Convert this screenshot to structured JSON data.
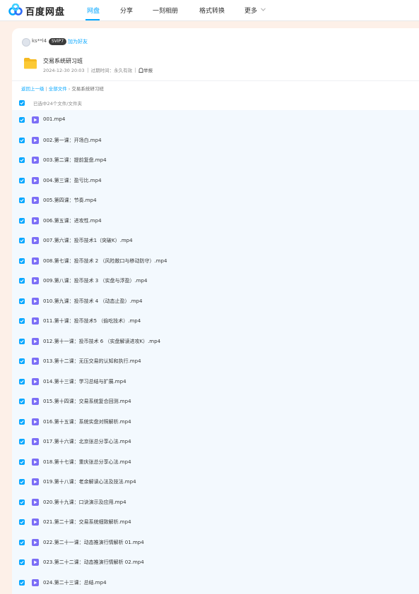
{
  "header": {
    "brand": "百度网盘",
    "nav": [
      "网盘",
      "分享",
      "一刻相册",
      "格式转换",
      "更多"
    ]
  },
  "colors": {
    "accent": "#06a7ff",
    "video_icon": "#7b6ef6",
    "list_bg": "#f3f9fe"
  },
  "share": {
    "username": "ks**l4",
    "vip": "SVIP7",
    "add_friend": "加为好友",
    "title": "交易系统研习班",
    "date": "2024-12-30 20:03",
    "expiry_label": "过期时间：",
    "expiry_value": "永久有效",
    "report": "举报"
  },
  "breadcrumb": {
    "back": "返回上一级",
    "all": "全部文件",
    "sep": "›",
    "current": "交易系统研习班"
  },
  "select_all": {
    "label": "已选中24个文件/文件夹"
  },
  "files": [
    {
      "name": "001.mp4"
    },
    {
      "name": "002.第一课：开场白.mp4"
    },
    {
      "name": "003.第二课：提前复盘.mp4"
    },
    {
      "name": "004.第三课：盈亏比.mp4"
    },
    {
      "name": "005.第四课：节奏.mp4"
    },
    {
      "name": "006.第五课：进攻性.mp4"
    },
    {
      "name": "007.第六课：投币技术1（突破K）.mp4"
    },
    {
      "name": "008.第七课：投币技术 2 （风险敞口与移动防守）.mp4"
    },
    {
      "name": "009.第八课：投币技术 3 （实盘与浮盈）.mp4"
    },
    {
      "name": "010.第九课：投币技术 4 （动态止盈）.mp4"
    },
    {
      "name": "011.第十课：投币技术5 （偷吃技术）.mp4"
    },
    {
      "name": "012.第十一课：投币技术 6 （实盘解读进攻K）.mp4"
    },
    {
      "name": "013.第十二课：无压交易的认知和执行.mp4"
    },
    {
      "name": "014.第十三课：学习总结与扩展.mp4"
    },
    {
      "name": "015.第十四课：交易系统复合回测.mp4"
    },
    {
      "name": "016.第十五课：系统实盘对照解析.mp4"
    },
    {
      "name": "017.第十六课：北京张总分享心法.mp4"
    },
    {
      "name": "018.第十七课：重庆张总分享心法.mp4"
    },
    {
      "name": "019.第十八课：老余解读心法及技法.mp4"
    },
    {
      "name": "020.第十九课：口诀演示及应用.mp4"
    },
    {
      "name": "021.第二十课：交易系统细致解析.mp4"
    },
    {
      "name": "022.第二十一课：动态推演行情解析 01.mp4"
    },
    {
      "name": "023.第二十二课：动态推演行情解析 02.mp4"
    },
    {
      "name": "024.第二十三课：总结.mp4"
    }
  ]
}
